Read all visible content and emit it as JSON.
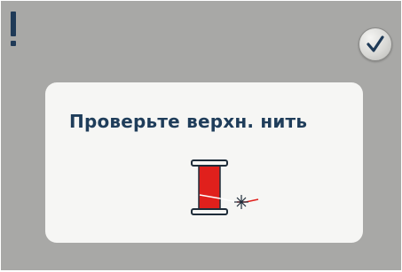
{
  "alert": {
    "icon": "exclamation-icon",
    "icon_color": "#1f3a57"
  },
  "confirm_button": {
    "icon": "checkmark-icon"
  },
  "dialog": {
    "message": "Проверьте верхн. нить",
    "illustration": "thread-spool-icon",
    "spool_color": "#e0201c",
    "text_color": "#1f3d5a"
  },
  "colors": {
    "background": "#a8a8a6",
    "panel": "#f6f6f4"
  }
}
